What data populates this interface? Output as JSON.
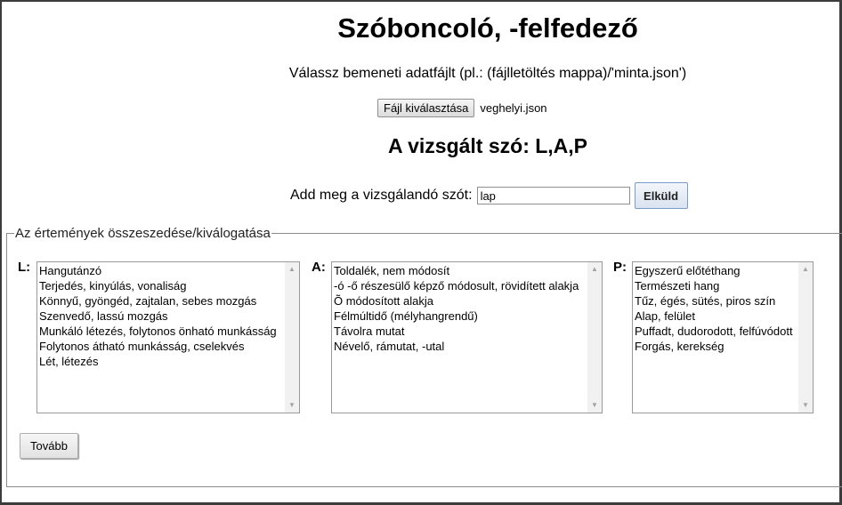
{
  "header": {
    "title": "Szóboncoló, -felfedező",
    "instruction": "Válassz bemeneti adatfájlt (pl.: (fájlletöltés mappa)/'minta.json')"
  },
  "file": {
    "button_label": "Fájl kiválasztása",
    "selected_name": "veghelyi.json"
  },
  "examined": {
    "heading": "A vizsgált szó: L,A,P"
  },
  "word_input": {
    "label": "Add meg a vizsgálandó szót:",
    "value": "lap",
    "submit_label": "Elküld"
  },
  "fieldset": {
    "legend": "Az értemények összeszedése/kiválogatása"
  },
  "columns": [
    {
      "letter": "L:",
      "items": [
        "Hangutánzó",
        "Terjedés, kinyúlás, vonaliság",
        "Könnyű, gyöngéd, zajtalan, sebes mozgás",
        "Szenvedő, lassú mozgás",
        "Munkáló létezés, folytonos önható munkásság",
        "Folytonos átható munkásság, cselekvés",
        "Lét, létezés"
      ]
    },
    {
      "letter": "A:",
      "items": [
        "Toldalék, nem módosít",
        "-ó -ő részesülő képző módosult, rövidített alakja",
        "Õ módosított alakja",
        "Félmúltidő (mélyhangrendű)",
        "Távolra mutat",
        "Névelő, rámutat, -utal"
      ]
    },
    {
      "letter": "P:",
      "items": [
        "Egyszerű előtéthang",
        "Természeti hang",
        "Tűz, égés, sütés, piros szín",
        "Alap, felület",
        "Puffadt, dudorodott, felfúvódott",
        "Forgás, kerekség"
      ]
    }
  ],
  "next_button": {
    "label": "Tovább"
  },
  "icons": {
    "scroll_up": "scroll-up-arrow-icon",
    "scroll_down": "scroll-down-arrow-icon"
  }
}
